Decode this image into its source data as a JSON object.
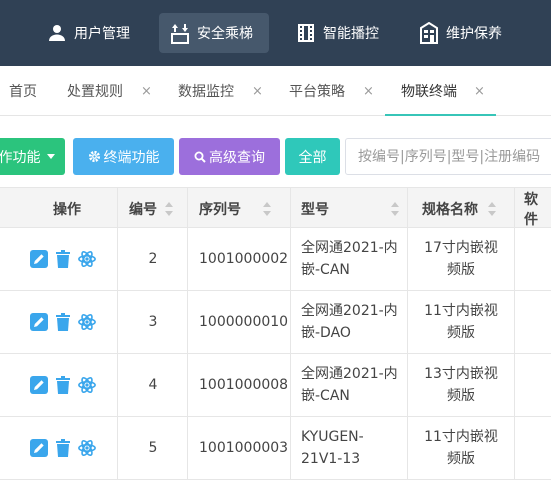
{
  "nav": {
    "items": [
      {
        "label": "用户管理",
        "icon": "user-icon"
      },
      {
        "label": "安全乘梯",
        "icon": "elevator-icon",
        "active": true
      },
      {
        "label": "智能播控",
        "icon": "film-icon"
      },
      {
        "label": "维护保养",
        "icon": "building-icon"
      }
    ]
  },
  "tabs": [
    {
      "label": "首页"
    },
    {
      "label": "处置规则",
      "close": "×"
    },
    {
      "label": "数据监控",
      "close": "×"
    },
    {
      "label": "平台策略",
      "close": "×"
    },
    {
      "label": "物联终端",
      "close": "×",
      "active": true
    }
  ],
  "toolbar": {
    "operate_label": "作功能",
    "terminal_label": "终端功能",
    "advanced_label": "高级查询",
    "all_label": "全部",
    "search_placeholder": "按编号|序列号|型号|注册编码"
  },
  "table": {
    "headers": {
      "ops": "操作",
      "num": "编号",
      "serial": "序列号",
      "model": "型号",
      "spec": "规格名称",
      "software": "软件"
    },
    "rows": [
      {
        "num": "2",
        "serial": "1001000002",
        "model_l1": "全网通2021-内",
        "model_l2": "嵌-CAN",
        "spec_l1": "17寸内嵌视",
        "spec_l2": "频版"
      },
      {
        "num": "3",
        "serial": "1000000010",
        "model_l1": "全网通2021-内",
        "model_l2": "嵌-DAO",
        "spec_l1": "11寸内嵌视",
        "spec_l2": "频版"
      },
      {
        "num": "4",
        "serial": "1001000008",
        "model_l1": "全网通2021-内",
        "model_l2": "嵌-CAN",
        "spec_l1": "13寸内嵌视",
        "spec_l2": "频版"
      },
      {
        "num": "5",
        "serial": "1001000003",
        "model_l1": "KYUGEN-",
        "model_l2": "21V1-13",
        "spec_l1": "11寸内嵌视",
        "spec_l2": "频版"
      }
    ]
  },
  "colors": {
    "nav_bg": "#304155",
    "accent": "#37c5b8",
    "icon_blue": "#3aa6ec"
  }
}
